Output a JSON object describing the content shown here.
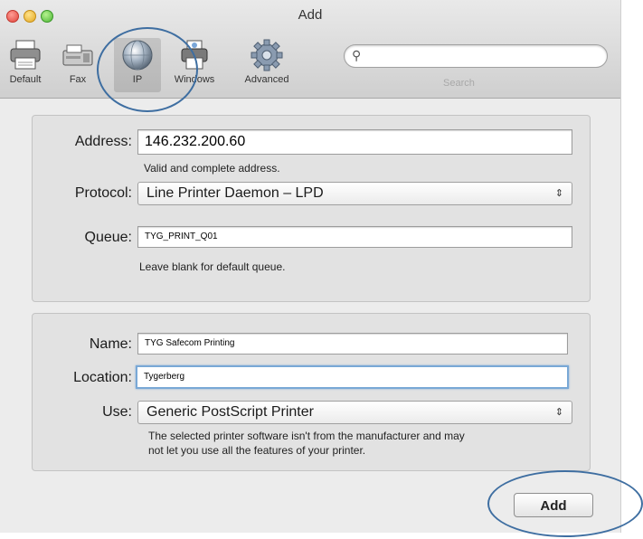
{
  "window": {
    "title": "Add"
  },
  "toolbar": {
    "items": [
      {
        "label": "Default",
        "icon": "printer-icon"
      },
      {
        "label": "Fax",
        "icon": "fax-icon"
      },
      {
        "label": "IP",
        "icon": "globe-icon",
        "selected": true
      },
      {
        "label": "Windows",
        "icon": "windows-printer-icon"
      },
      {
        "label": "Advanced",
        "icon": "gear-icon"
      }
    ],
    "search": {
      "placeholder": "",
      "label": "Search",
      "icon": "search-icon"
    }
  },
  "connection": {
    "address_label": "Address:",
    "address_value": "146.232.200.60",
    "address_hint": "Valid and complete address.",
    "protocol_label": "Protocol:",
    "protocol_value": "Line Printer Daemon – LPD",
    "queue_label": "Queue:",
    "queue_value": "TYG_PRINT_Q01",
    "queue_hint": "Leave blank for default queue."
  },
  "details": {
    "name_label": "Name:",
    "name_value": "TYG Safecom Printing",
    "location_label": "Location:",
    "location_value": "Tygerberg",
    "use_label": "Use:",
    "use_value": "Generic PostScript Printer",
    "use_hint_line1": "The selected printer software isn't from the manufacturer and may",
    "use_hint_line2": "not let you use all the features of your printer."
  },
  "actions": {
    "add_label": "Add"
  },
  "colors": {
    "annotation": "#3e6ea1",
    "focus": "#79a8d6"
  }
}
